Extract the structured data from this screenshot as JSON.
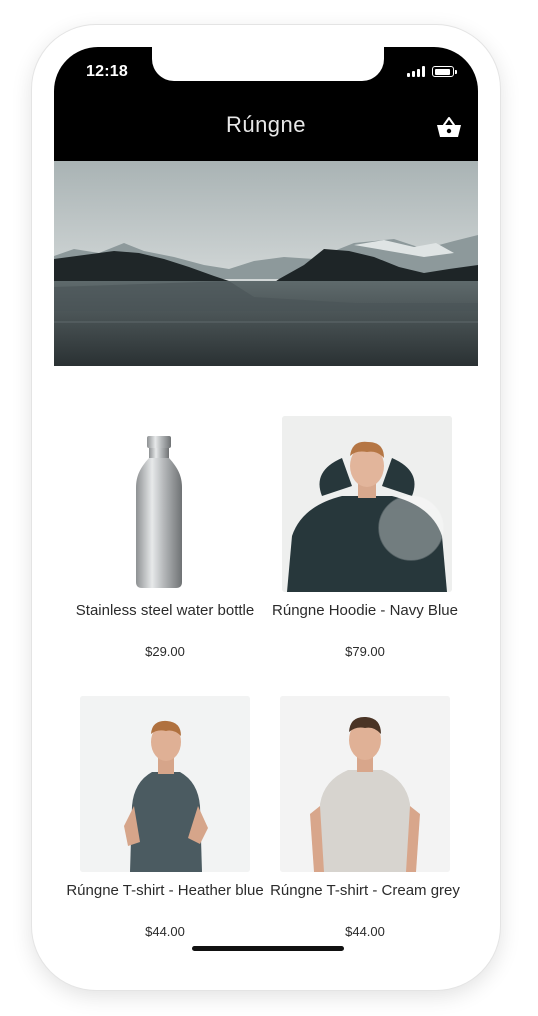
{
  "status_bar": {
    "time": "12:18"
  },
  "header": {
    "title": "Rúngne",
    "cart_icon": "basket-icon",
    "background": "#000000"
  },
  "products": [
    {
      "name": "Stainless steel water bottle",
      "price": "$29.00",
      "image": "water-bottle"
    },
    {
      "name": "Rúngne Hoodie - Navy Blue",
      "price": "$79.00",
      "image": "hoodie"
    },
    {
      "name": "Rúngne T-shirt - Heather blue",
      "price": "$44.00",
      "image": "tshirt-blue"
    },
    {
      "name": "Rúngne T-shirt - Cream grey",
      "price": "$44.00",
      "image": "tshirt-grey"
    }
  ]
}
